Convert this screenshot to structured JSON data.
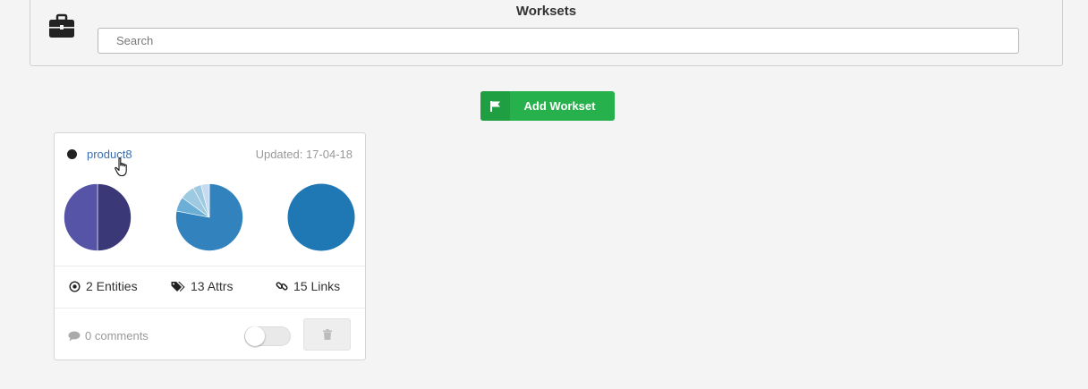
{
  "header": {
    "title": "Worksets",
    "icon": "briefcase-icon",
    "search": {
      "placeholder": "Search",
      "value": ""
    }
  },
  "actions": {
    "add_label": "Add Workset",
    "add_icon": "flag-icon",
    "color": "#26b14c"
  },
  "workset": {
    "name": "product8",
    "updated": "Updated: 17-04-18",
    "status_color": "#222222",
    "stats": {
      "entities": "2 Entities",
      "attrs": "13 Attrs",
      "links": "15 Links"
    },
    "comments": "0 comments",
    "toggle_on": false
  },
  "chart_data": [
    {
      "type": "pie",
      "title": "",
      "values": [
        50,
        50
      ],
      "colors": [
        "#3b3878",
        "#5554a6"
      ]
    },
    {
      "type": "pie",
      "title": "",
      "values": [
        78,
        7,
        7,
        4,
        4
      ],
      "colors": [
        "#3182bd",
        "#6baed6",
        "#9ecae1",
        "#9ecae1",
        "#c6dbef"
      ]
    },
    {
      "type": "pie",
      "title": "",
      "values": [
        100
      ],
      "colors": [
        "#1f77b4"
      ]
    }
  ]
}
